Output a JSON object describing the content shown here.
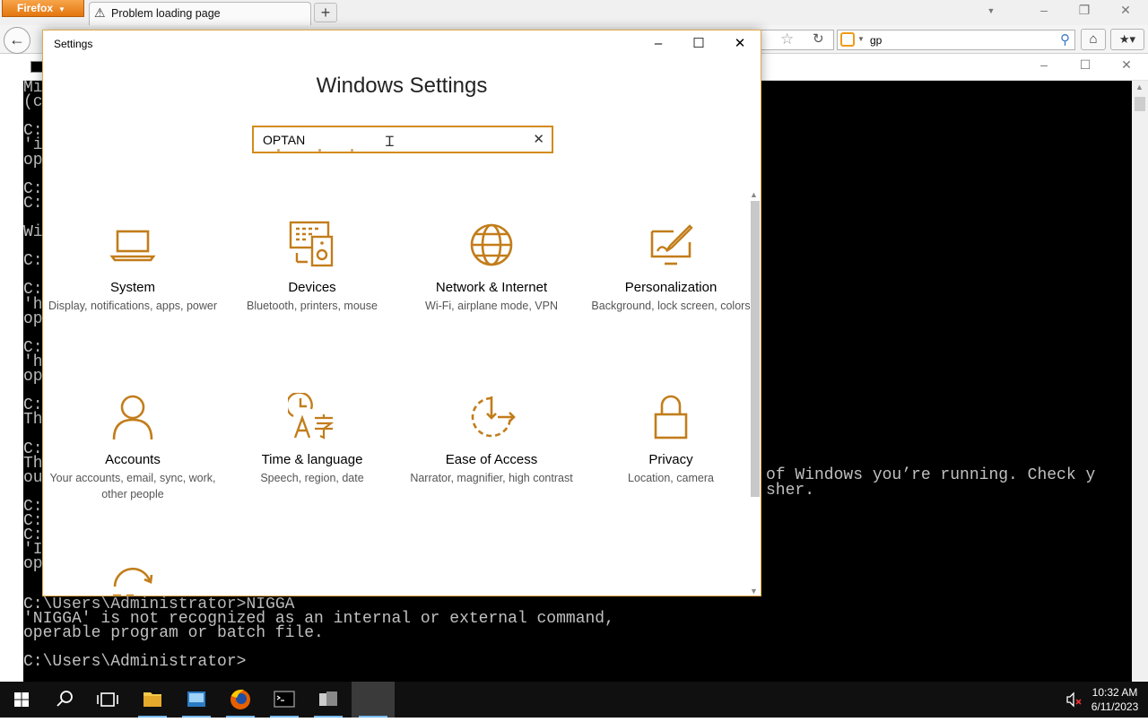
{
  "firefox": {
    "menu_label": "Firefox",
    "tab_title": "Problem loading page",
    "new_tab_label": "+",
    "search_value": "gp"
  },
  "cmd": {
    "left_fragments": [
      "Mi",
      "(c",
      "",
      "C:",
      "'i",
      "op",
      "",
      "C:",
      "C:",
      "",
      "Wi",
      "",
      "C:",
      "",
      "C:",
      "'h",
      "op",
      "",
      "C:",
      "'h",
      "op",
      "",
      "C:",
      "Th",
      "",
      "C:",
      "Th",
      "ou",
      "",
      "C:",
      "C:",
      "C:",
      "'I",
      "op"
    ],
    "right_line_1": "of Windows you’re running. Check y",
    "right_line_2": "sher.",
    "bottom_lines": [
      "C:\\Users\\Administrator>NIGGA",
      "'NIGGA' is not recognized as an internal or external command,",
      "operable program or batch file.",
      "",
      "C:\\Users\\Administrator>"
    ]
  },
  "settings": {
    "window_title": "Settings",
    "heading": "Windows Settings",
    "search_value": "OPTAN",
    "accent_color": "#c27d1a",
    "tiles": [
      {
        "title": "System",
        "desc": "Display, notifications, apps, power",
        "icon": "laptop-icon"
      },
      {
        "title": "Devices",
        "desc": "Bluetooth, printers, mouse",
        "icon": "devices-icon"
      },
      {
        "title": "Network & Internet",
        "desc": "Wi-Fi, airplane mode, VPN",
        "icon": "globe-icon"
      },
      {
        "title": "Personalization",
        "desc": "Background, lock screen, colors",
        "icon": "paintbrush-icon"
      },
      {
        "title": "Accounts",
        "desc": "Your accounts, email, sync, work, other people",
        "icon": "person-icon"
      },
      {
        "title": "Time & language",
        "desc": "Speech, region, date",
        "icon": "time-language-icon"
      },
      {
        "title": "Ease of Access",
        "desc": "Narrator, magnifier, high contrast",
        "icon": "ease-of-access-icon"
      },
      {
        "title": "Privacy",
        "desc": "Location, camera",
        "icon": "lock-icon"
      }
    ]
  },
  "taskbar": {
    "time": "10:32 AM",
    "date": "6/11/2023"
  }
}
